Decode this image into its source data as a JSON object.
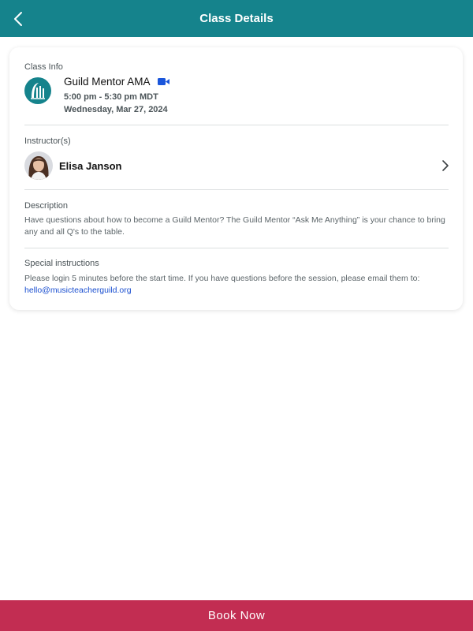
{
  "header": {
    "title": "Class Details",
    "back_icon": "chevron-left-icon"
  },
  "class_info": {
    "label": "Class Info",
    "title": "Guild Mentor AMA",
    "time": "5:00 pm - 5:30 pm MDT",
    "date": "Wednesday, Mar 27, 2024",
    "logo_icon": "guild-logo-icon",
    "video_icon": "video-camera-icon"
  },
  "instructors": {
    "label": "Instructor(s)",
    "items": [
      {
        "name": "Elisa Janson"
      }
    ]
  },
  "description": {
    "label": "Description",
    "text": "Have questions about how to become a Guild Mentor? The Guild Mentor “Ask Me Anything” is your chance to bring any and all Q's to the table."
  },
  "special_instructions": {
    "label": "Special instructions",
    "text": "Please login 5 minutes before the start time. If you have questions before the session, please email them to:",
    "email": "hello@musicteacherguild.org"
  },
  "footer": {
    "book_label": "Book Now"
  },
  "colors": {
    "header_bg": "#15838c",
    "book_button_bg": "#c22d52",
    "link": "#1a4fd0",
    "video_icon": "#1a56db"
  }
}
